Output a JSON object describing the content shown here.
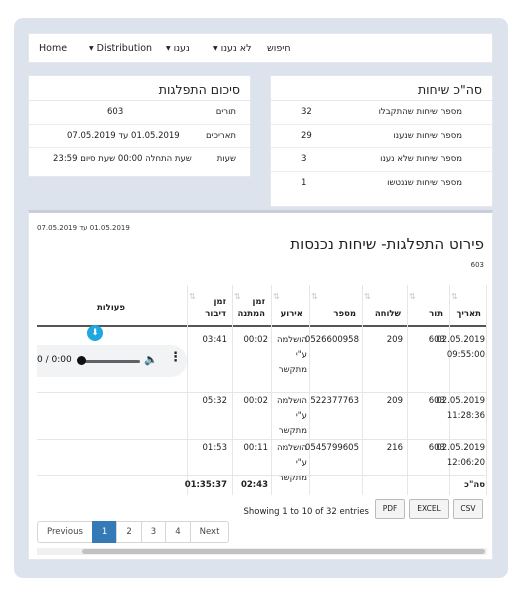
{
  "nav": {
    "home": "Home",
    "distribution": "Distribution",
    "answered": "נענו",
    "not_answered": "לא נענו",
    "search": "חיפוש"
  },
  "calls_summary": {
    "title": "סה\"כ שיחות",
    "rows": [
      {
        "label": "מספר שיחות שהתקבלו",
        "value": "32"
      },
      {
        "label": "מספר שיחות שנענו",
        "value": "29"
      },
      {
        "label": "מספר שיחות שלא נענו",
        "value": "3"
      },
      {
        "label": "מספר שיחות שננטשו",
        "value": "1"
      }
    ]
  },
  "distribution_summary": {
    "title": "סיכום התפלגות",
    "rows": [
      {
        "label": "תורים",
        "value": "603"
      },
      {
        "label": "תאריכים",
        "value": "01.05.2019 עד 07.05.2019"
      },
      {
        "label": "שעות",
        "value": "שעת התחלה 00:00 שעת סיום 23:59"
      }
    ]
  },
  "detail": {
    "period": "01.05.2019 עד 07.05.2019",
    "title": "פירוט התפלגות- שיחות נכנסות",
    "queue": "603",
    "columns": [
      "תאריך",
      "תור",
      "שלוחה",
      "מספר",
      "אירוע",
      "זמן המתנה",
      "זמן דיבור",
      "פעולות"
    ],
    "rows": [
      {
        "date": "02.05.2019 09:55:00",
        "queue": "603",
        "ext": "209",
        "number": "0526600958",
        "event": "הושלמה ע\"י מתקשר",
        "wait": "00:02",
        "talk": "03:41"
      },
      {
        "date": "02.05.2019 11:28:36",
        "queue": "603",
        "ext": "209",
        "number": "522377763",
        "event": "הושלמה ע\"י מתקשר",
        "wait": "00:02",
        "talk": "05:32"
      },
      {
        "date": "02.05.2019 12:06:20",
        "queue": "603",
        "ext": "216",
        "number": "0545799605",
        "event": "הושלמה ע\"י מתקשר",
        "wait": "00:11",
        "talk": "01:53"
      }
    ],
    "totals": {
      "label": "סה\"כ",
      "wait": "02:43",
      "talk": "01:35:37"
    },
    "player_time": "0 / 0:00",
    "showing": "Showing 1 to 10 of 32 entries",
    "export": {
      "pdf": "PDF",
      "excel": "EXCEL",
      "csv": "CSV"
    },
    "pagination": {
      "previous": "Previous",
      "pages": [
        "1",
        "2",
        "3",
        "4"
      ],
      "next": "Next"
    }
  }
}
